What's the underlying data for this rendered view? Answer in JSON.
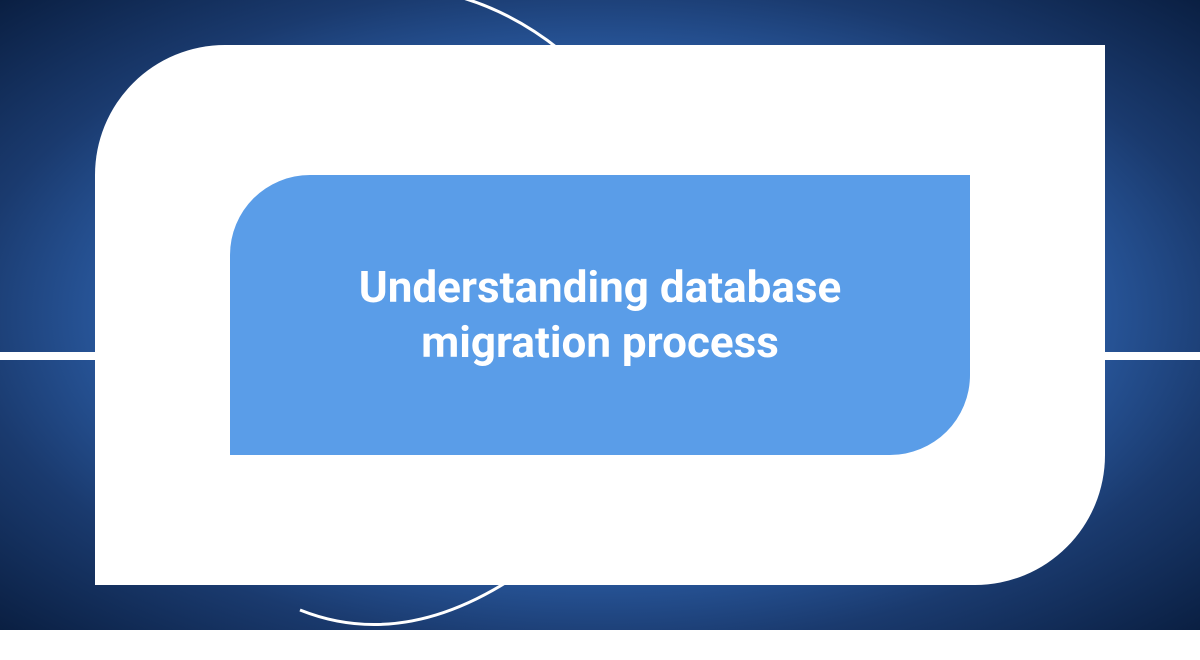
{
  "banner": {
    "title": "Understanding database migration process"
  },
  "colors": {
    "bg_center": "#5a9de8",
    "bg_edge": "#0a1f42",
    "shape": "#ffffff",
    "inner": "#5a9de8",
    "text": "#ffffff"
  }
}
